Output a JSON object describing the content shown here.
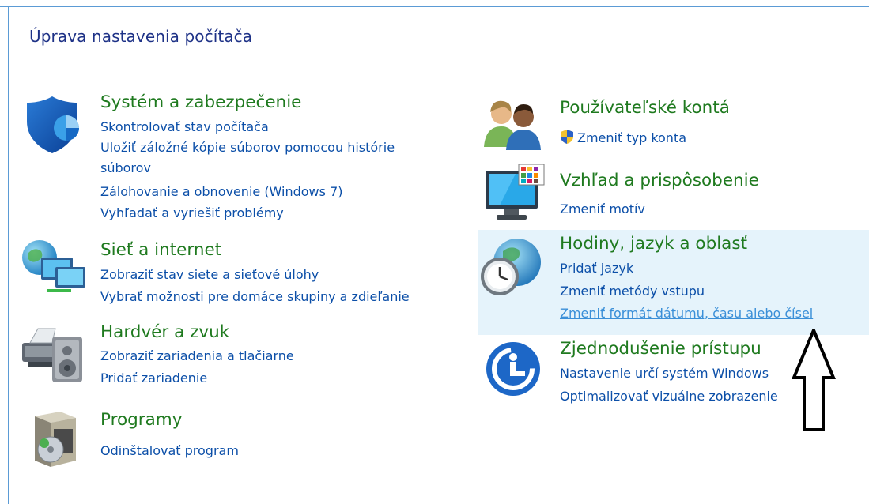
{
  "page_title": "Úprava nastavenia počítača",
  "left_column": {
    "system": {
      "title": "Systém a zabezpečenie",
      "links": [
        "Skontrolovať stav počítača",
        "Uložiť záložné kópie súborov pomocou histórie súborov",
        "Zálohovanie a obnovenie (Windows 7)",
        "Vyhľadať a vyriešiť problémy"
      ]
    },
    "network": {
      "title": "Sieť a internet",
      "links": [
        "Zobraziť stav siete a sieťové úlohy",
        "Vybrať možnosti pre domáce skupiny a zdieľanie"
      ]
    },
    "hardware": {
      "title": "Hardvér a zvuk",
      "links": [
        "Zobraziť zariadenia a tlačiarne",
        "Pridať zariadenie"
      ]
    },
    "programs": {
      "title": "Programy",
      "links": [
        "Odinštalovať program"
      ]
    }
  },
  "right_column": {
    "accounts": {
      "title": "Používateľské kontá",
      "links": [
        "Zmeniť typ konta"
      ]
    },
    "appearance": {
      "title": "Vzhľad a prispôsobenie",
      "links": [
        "Zmeniť motív"
      ]
    },
    "clock": {
      "title": "Hodiny, jazyk a oblasť",
      "links": [
        "Pridať jazyk",
        "Zmeniť metódy vstupu",
        "Zmeniť formát dátumu, času alebo čísel"
      ]
    },
    "access": {
      "title": "Zjednodušenie prístupu",
      "links": [
        "Nastavenie určí systém Windows",
        "Optimalizovať vizuálne zobrazenie"
      ]
    }
  },
  "icons": {
    "system": "shield-icon",
    "network": "network-globe-icon",
    "hardware": "printer-speaker-icon",
    "programs": "programs-box-icon",
    "accounts": "users-icon",
    "appearance": "monitor-palette-icon",
    "clock": "globe-clock-icon",
    "access": "ease-of-access-icon",
    "uac": "uac-shield-icon",
    "annotation": "arrow-up-annotation"
  },
  "colors": {
    "category_title": "#1f7a1f",
    "link": "#0c4fa8",
    "page_title": "#1e3287",
    "highlight": "#e5f3fb"
  }
}
